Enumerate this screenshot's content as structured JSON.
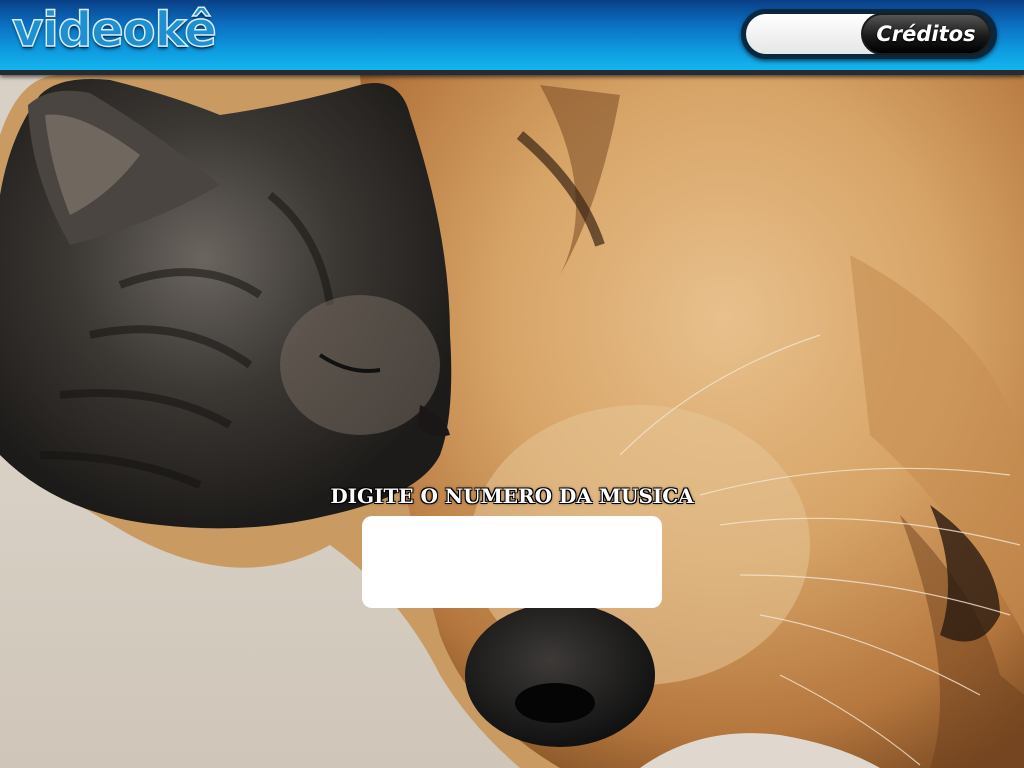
{
  "app": {
    "logo_text": "videokê"
  },
  "header": {
    "credits_field_value": "",
    "credits_button_label": "Créditos"
  },
  "main": {
    "prompt_label": "DIGITE O NUMERO DA MUSICA",
    "song_number_value": ""
  },
  "background": {
    "image_description": "kitten-and-dog-photo"
  },
  "colors": {
    "header_blue": "#0e98de",
    "header_border": "#262b33",
    "button_black": "#1b1b1b",
    "input_white": "#ffffff"
  }
}
